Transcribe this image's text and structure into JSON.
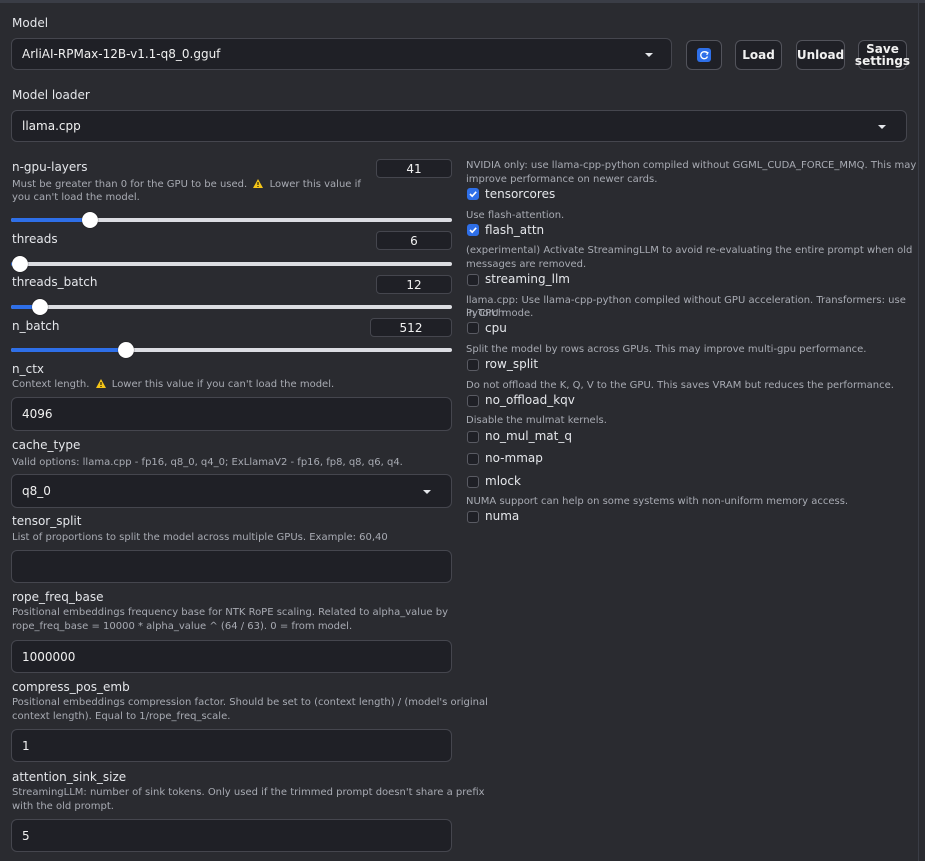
{
  "model": {
    "label": "Model",
    "selected": "ArliAI-RPMax-12B-v1.1-q8_0.gguf",
    "refresh_icon": "refresh-icon",
    "load_label": "Load",
    "unload_label": "Unload",
    "save_label_line1": "Save",
    "save_label_line2": "settings"
  },
  "loader": {
    "label": "Model loader",
    "selected": "llama.cpp"
  },
  "sliders": {
    "n_gpu_layers": {
      "label": "n-gpu-layers",
      "value": "41",
      "fraction": 0.18,
      "hint_part1": "Must be greater than 0 for the GPU to be used.",
      "hint_part2": "Lower this value if you can't load the model.",
      "warn_icon": "warning-icon"
    },
    "threads": {
      "label": "threads",
      "value": "6",
      "fraction": 0.02
    },
    "threads_batch": {
      "label": "threads_batch",
      "value": "12",
      "fraction": 0.065
    },
    "n_batch": {
      "label": "n_batch",
      "value": "512",
      "fraction": 0.26
    }
  },
  "n_ctx": {
    "label": "n_ctx",
    "hint_part1": "Context length.",
    "hint_part2": "Lower this value if you can't load the model.",
    "value": "4096"
  },
  "cache_type": {
    "label": "cache_type",
    "hint": "Valid options: llama.cpp - fp16, q8_0, q4_0; ExLlamaV2 - fp16, fp8, q8, q6, q4.",
    "selected": "q8_0"
  },
  "tensor_split": {
    "label": "tensor_split",
    "hint": "List of proportions to split the model across multiple GPUs. Example: 60,40",
    "value": ""
  },
  "rope_freq_base": {
    "label": "rope_freq_base",
    "hint_line1": "Positional embeddings frequency base for NTK RoPE scaling. Related to alpha_value by",
    "hint_line2": "rope_freq_base = 10000 * alpha_value ^ (64 / 63). 0 = from model.",
    "value": "1000000"
  },
  "compress_pos_emb": {
    "label": "compress_pos_emb",
    "hint_line1": "Positional embeddings compression factor. Should be set to (context length) / (model's original",
    "hint_line2": "context length). Equal to 1/rope_freq_scale.",
    "value": "1"
  },
  "attention_sink_size": {
    "label": "attention_sink_size",
    "hint_line1": "StreamingLLM: number of sink tokens. Only used if the trimmed prompt doesn't share a prefix",
    "hint_line2": "with the old prompt.",
    "value": "5"
  },
  "checkboxes": {
    "tensorcores": {
      "hint_line1": "NVIDIA only: use llama-cpp-python compiled without GGML_CUDA_FORCE_MMQ. This may",
      "hint_line2": "improve performance on newer cards.",
      "label": "tensorcores",
      "checked": true
    },
    "flash_attn": {
      "hint_line1": "Use flash-attention.",
      "label": "flash_attn",
      "checked": true
    },
    "streaming_llm": {
      "hint_line1": "(experimental) Activate StreamingLLM to avoid re-evaluating the entire prompt when old",
      "hint_line2": "messages are removed.",
      "label": "streaming_llm",
      "checked": false
    },
    "cpu": {
      "hint_line1": "llama.cpp: Use llama-cpp-python compiled without GPU acceleration. Transformers: use PyTorch",
      "hint_line2": "in CPU mode.",
      "label": "cpu",
      "checked": false
    },
    "row_split": {
      "hint_line1": "Split the model by rows across GPUs. This may improve multi-gpu performance.",
      "label": "row_split",
      "checked": false
    },
    "no_offload_kqv": {
      "hint_line1": "Do not offload the K, Q, V to the GPU. This saves VRAM but reduces the performance.",
      "label": "no_offload_kqv",
      "checked": false
    },
    "no_mul_mat_q": {
      "hint_line1": "Disable the mulmat kernels.",
      "label": "no_mul_mat_q",
      "checked": false
    },
    "no_mmap": {
      "label": "no-mmap",
      "checked": false
    },
    "mlock": {
      "label": "mlock",
      "checked": false
    },
    "numa": {
      "hint_line1": "NUMA support can help on some systems with non-uniform memory access.",
      "label": "numa",
      "checked": false
    }
  },
  "colors": {
    "accent": "#2e6fe8",
    "panel": "#2a2b30",
    "input": "#1f2026",
    "warning": "#f5c518"
  }
}
